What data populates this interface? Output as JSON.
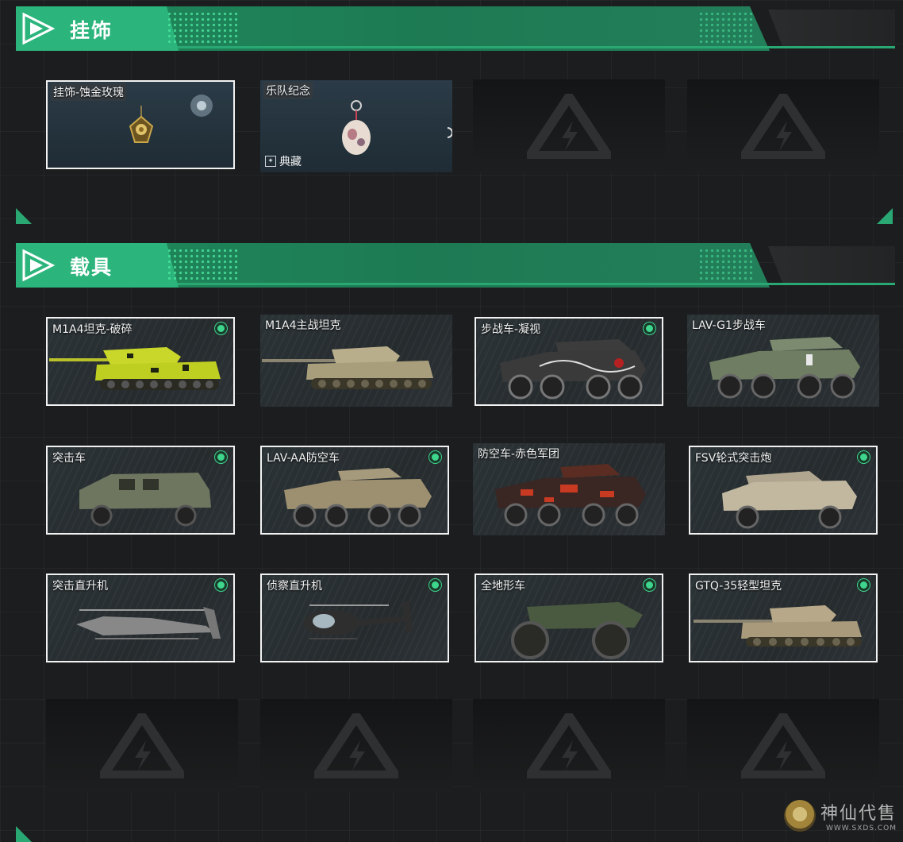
{
  "sections": {
    "charms": {
      "title": "挂饰"
    },
    "vehicles": {
      "title": "载具"
    }
  },
  "charms": [
    {
      "label": "挂饰-蚀金玫瑰",
      "selected": true
    },
    {
      "label": "乐队纪念",
      "rarity": "典藏",
      "selected": false
    }
  ],
  "vehicles": [
    {
      "label": "M1A4坦克-破碎",
      "selected": true,
      "owned": true
    },
    {
      "label": "M1A4主战坦克",
      "selected": false,
      "owned": false
    },
    {
      "label": "步战车-凝视",
      "selected": true,
      "owned": true
    },
    {
      "label": "LAV-G1步战车",
      "selected": false,
      "owned": false
    },
    {
      "label": "突击车",
      "selected": true,
      "owned": true
    },
    {
      "label": "LAV-AA防空车",
      "selected": true,
      "owned": true
    },
    {
      "label": "防空车-赤色军团",
      "selected": false,
      "owned": false
    },
    {
      "label": "FSV轮式突击炮",
      "selected": true,
      "owned": true
    },
    {
      "label": "突击直升机",
      "selected": true,
      "owned": true
    },
    {
      "label": "侦察直升机",
      "selected": true,
      "owned": true
    },
    {
      "label": "全地形车",
      "selected": true,
      "owned": true
    },
    {
      "label": "GTQ-35轻型坦克",
      "selected": true,
      "owned": true
    }
  ],
  "icons": {
    "section": "chevron-triangle-icon",
    "empty_slot": "lightning-triangle-logo-icon",
    "status": "owned-dot-icon"
  },
  "colors": {
    "accent": "#2bb47b",
    "status_green": "#3ed68c",
    "background": "#1c1d1e",
    "selected_border": "#f2f2f2"
  },
  "watermark": {
    "text": "神仙代售",
    "sub": "WWW.SXDS.COM"
  }
}
